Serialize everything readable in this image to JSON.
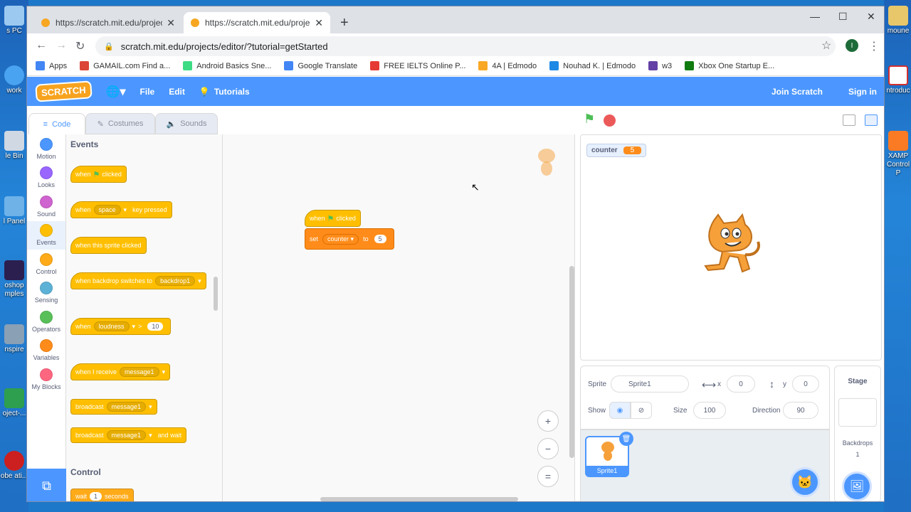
{
  "desktop": {
    "left_icons": [
      "s PC",
      "work",
      "le Bin",
      "l Panel",
      "oshop\nmples",
      "nspire",
      "oject-...",
      "obe\nati..."
    ],
    "right_icons": [
      "moune",
      "ntroduc",
      "XAMP\nControl P"
    ]
  },
  "browser": {
    "tabs": [
      {
        "title": "https://scratch.mit.edu/projects/e"
      },
      {
        "title": "https://scratch.mit.edu/projects/e"
      }
    ],
    "url": "scratch.mit.edu/projects/editor/?tutorial=getStarted",
    "profile_initial": "I",
    "bookmarks": [
      {
        "label": "Apps",
        "color": "#4285f4"
      },
      {
        "label": "GAMAIL.com Find a...",
        "color": "#db4437"
      },
      {
        "label": "Android Basics Sne...",
        "color": "#3ddc84"
      },
      {
        "label": "Google Translate",
        "color": "#4285f4"
      },
      {
        "label": "FREE IELTS Online P...",
        "color": "#e53935"
      },
      {
        "label": "4A | Edmodo",
        "color": "#f9a825"
      },
      {
        "label": "Nouhad K. | Edmodo",
        "color": "#1e88e5"
      },
      {
        "label": "w3",
        "color": "#6441a5"
      },
      {
        "label": "Xbox One Startup E...",
        "color": "#107c10"
      }
    ]
  },
  "scratch": {
    "logo": "SCRATCH",
    "menu": {
      "file": "File",
      "edit": "Edit",
      "tutorials": "Tutorials",
      "join": "Join Scratch",
      "signin": "Sign in"
    },
    "editor_tabs": {
      "code": "Code",
      "costumes": "Costumes",
      "sounds": "Sounds"
    },
    "categories": [
      {
        "label": "Motion",
        "color": "#4c97ff"
      },
      {
        "label": "Looks",
        "color": "#9966ff"
      },
      {
        "label": "Sound",
        "color": "#cf63cf"
      },
      {
        "label": "Events",
        "color": "#ffbf00"
      },
      {
        "label": "Control",
        "color": "#ffab19"
      },
      {
        "label": "Sensing",
        "color": "#5cb1d6"
      },
      {
        "label": "Operators",
        "color": "#59c059"
      },
      {
        "label": "Variables",
        "color": "#ff8c1a"
      },
      {
        "label": "My Blocks",
        "color": "#ff6680"
      }
    ],
    "palette": {
      "events_heading": "Events",
      "control_heading": "Control",
      "when": "when",
      "clicked": "clicked",
      "space": "space",
      "key_pressed": "key pressed",
      "sprite_clicked": "when this sprite clicked",
      "backdrop_switches": "when backdrop switches to",
      "backdrop1": "backdrop1",
      "loudness": "loudness",
      "gt": ">",
      "ten": "10",
      "when_i_receive": "when I receive",
      "message1": "message1",
      "broadcast": "broadcast",
      "and_wait": "and wait",
      "wait": "wait",
      "one": "1",
      "seconds": "seconds"
    },
    "script": {
      "when": "when",
      "clicked": "clicked",
      "set": "set",
      "var": "counter",
      "to": "to",
      "value": "5"
    },
    "zoom": {
      "in": "+",
      "out": "−",
      "reset": "="
    },
    "monitor": {
      "name": "counter",
      "value": "5"
    },
    "sprite_info": {
      "sprite_label": "Sprite",
      "sprite_name": "Sprite1",
      "x_label": "x",
      "x": "0",
      "y_label": "y",
      "y": "0",
      "show_label": "Show",
      "size_label": "Size",
      "size": "100",
      "direction_label": "Direction",
      "direction": "90"
    },
    "sprite_tile": "Sprite1",
    "stage_panel": {
      "title": "Stage",
      "backdrops_label": "Backdrops",
      "backdrops_count": "1"
    }
  }
}
